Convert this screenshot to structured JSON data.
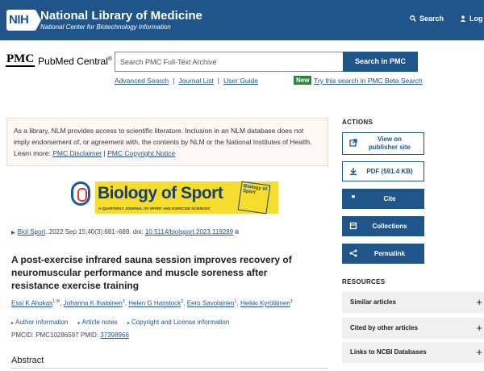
{
  "header": {
    "logo_text": "NIH",
    "title": "National Library of Medicine",
    "subtitle": "National Center for Biotechnology Information",
    "search_label": "Search",
    "login_label": "Log"
  },
  "pmc": {
    "logo_box": "PMC",
    "logo_name": "PubMed Central",
    "logo_reg": "®",
    "search_placeholder": "Search PMC Full-Text Archive",
    "search_button": "Search in PMC",
    "links": [
      "Advanced Search",
      "Journal List",
      "User Guide"
    ],
    "new_badge": "New",
    "beta_link": "Try this search in PMC Beta Search"
  },
  "disclaimer": {
    "text": "As a library, NLM provides access to scientific literature. Inclusion in an NLM database does not imply endorsement of, or agreement with, the contents by NLM or the National Institutes of Health.",
    "learn_more": "Learn more:",
    "link1": "PMC Disclaimer",
    "sep": "|",
    "link2": "PMC Copyright Notice"
  },
  "journal": {
    "title": "Biology of Sport",
    "tagline": "A QUARTERLY JOURNAL OF SPORT AND EXERCISE SCIENCES",
    "cover_text": "Biology of Sport"
  },
  "citation": {
    "journal_link": "Biol Sport",
    "details": ". 2022 Sep 15;40(3):681–689. doi:",
    "doi": "10.5114/biolsport.2023.119289"
  },
  "article": {
    "title": "A post-exercise infrared sauna session improves recovery of neuromuscular performance and muscle soreness after resistance exercise training",
    "authors": [
      {
        "name": "Essi K Ahokas",
        "sup": "1,✉"
      },
      {
        "name": "Johanna K Ihalainen",
        "sup": "1"
      },
      {
        "name": "Helen G Hanstock",
        "sup": "2"
      },
      {
        "name": "Eero Savolainen",
        "sup": "1"
      },
      {
        "name": "Heikki Kyröläinen",
        "sup": "1"
      }
    ],
    "meta_links": [
      "Author information",
      "Article notes",
      "Copyright and License information"
    ],
    "pmcid_label": "PMCID: PMC10286597",
    "pmid_label": "PMID:",
    "pmid": "37398966",
    "abstract_heading": "Abstract"
  },
  "sidebar": {
    "actions_heading": "ACTIONS",
    "actions": [
      {
        "label": "View on publisher site",
        "icon": "external-link-icon"
      },
      {
        "label": "PDF (591.4 KB)",
        "icon": "download-icon"
      },
      {
        "label": "Cite",
        "icon": "quote-icon"
      },
      {
        "label": "Collections",
        "icon": "collections-icon"
      },
      {
        "label": "Permalink",
        "icon": "share-icon"
      }
    ],
    "resources_heading": "RESOURCES",
    "resources": [
      "Similar articles",
      "Cited by other articles",
      "Links to NCBI Databases"
    ]
  },
  "colors": {
    "brand": "#20558a",
    "new_badge": "#2e8540",
    "journal_yellow": "#f6dd2d"
  }
}
